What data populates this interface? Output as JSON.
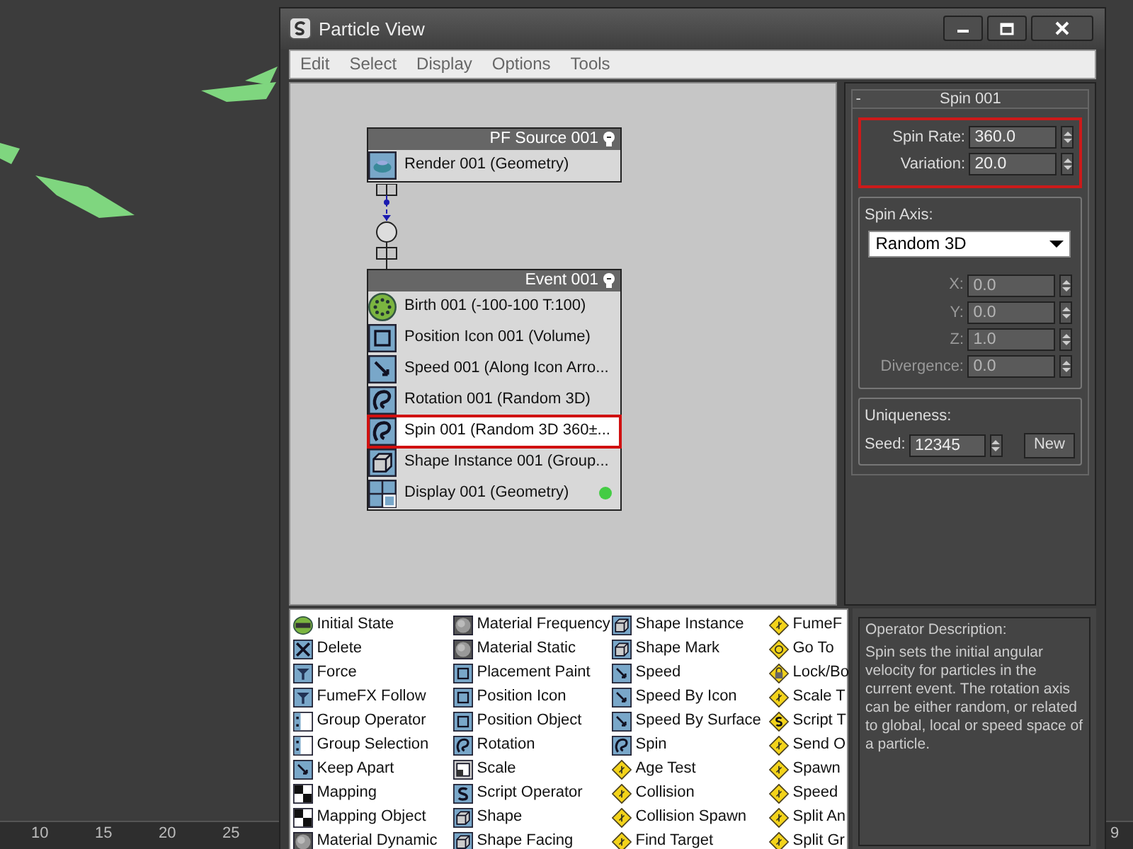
{
  "viewport": {
    "ruler_labels": [
      "10",
      "15",
      "20",
      "25",
      "9"
    ]
  },
  "window": {
    "title": "Particle View"
  },
  "menu": [
    "Edit",
    "Select",
    "Display",
    "Options",
    "Tools"
  ],
  "nodes": [
    {
      "title": "PF Source 001",
      "items": [
        {
          "label": "Render 001 (Geometry)",
          "kind": "render",
          "selected": false,
          "highlighted": false
        }
      ]
    },
    {
      "title": "Event 001",
      "items": [
        {
          "label": "Birth 001 (-100-100 T:100)",
          "kind": "birth",
          "selected": false,
          "highlighted": false
        },
        {
          "label": "Position Icon 001 (Volume)",
          "kind": "position",
          "selected": false,
          "highlighted": false
        },
        {
          "label": "Speed 001 (Along Icon Arro...",
          "kind": "speed",
          "selected": false,
          "highlighted": false
        },
        {
          "label": "Rotation 001 (Random 3D)",
          "kind": "rotation",
          "selected": false,
          "highlighted": false
        },
        {
          "label": "Spin 001 (Random 3D 360±...",
          "kind": "rotation",
          "selected": true,
          "highlighted": true
        },
        {
          "label": "Shape Instance 001 (Group...",
          "kind": "shape",
          "selected": false,
          "highlighted": false
        },
        {
          "label": "Display 001 (Geometry)",
          "kind": "display",
          "selected": false,
          "highlighted": false,
          "color": "#44cc44"
        }
      ]
    }
  ],
  "rollout": {
    "title": "Spin 001",
    "collapse": "-",
    "rate_group": {
      "highlighted": true,
      "fields": [
        {
          "label": "Spin Rate:",
          "value": "360.0",
          "disabled": false
        },
        {
          "label": "Variation:",
          "value": "20.0",
          "disabled": false
        }
      ]
    },
    "axis_group": {
      "title": "Spin Axis:",
      "dropdown": "Random 3D",
      "fields": [
        {
          "label": "X:",
          "value": "0.0",
          "disabled": true
        },
        {
          "label": "Y:",
          "value": "0.0",
          "disabled": true
        },
        {
          "label": "Z:",
          "value": "1.0",
          "disabled": true
        },
        {
          "label": "Divergence:",
          "value": "0.0",
          "disabled": true
        }
      ]
    },
    "uniqueness": {
      "title": "Uniqueness:",
      "label": "Seed:",
      "value": "12345",
      "button": "New"
    }
  },
  "depot": [
    [
      {
        "label": "Initial State",
        "kind": "initial"
      },
      {
        "label": "Delete",
        "kind": "delete"
      },
      {
        "label": "Force",
        "kind": "force"
      },
      {
        "label": "FumeFX Follow",
        "kind": "force"
      },
      {
        "label": "Group Operator",
        "kind": "group"
      },
      {
        "label": "Group Selection",
        "kind": "group"
      },
      {
        "label": "Keep Apart",
        "kind": "speed"
      },
      {
        "label": "Mapping",
        "kind": "mapping"
      },
      {
        "label": "Mapping Object",
        "kind": "mapping"
      },
      {
        "label": "Material Dynamic",
        "kind": "material"
      }
    ],
    [
      {
        "label": "Material Frequency",
        "kind": "material"
      },
      {
        "label": "Material Static",
        "kind": "material"
      },
      {
        "label": "Placement Paint",
        "kind": "position"
      },
      {
        "label": "Position Icon",
        "kind": "position"
      },
      {
        "label": "Position Object",
        "kind": "position"
      },
      {
        "label": "Rotation",
        "kind": "rotation"
      },
      {
        "label": "Scale",
        "kind": "scale"
      },
      {
        "label": "Script Operator",
        "kind": "script"
      },
      {
        "label": "Shape",
        "kind": "shape"
      },
      {
        "label": "Shape Facing",
        "kind": "shape"
      }
    ],
    [
      {
        "label": "Shape Instance",
        "kind": "shape"
      },
      {
        "label": "Shape Mark",
        "kind": "shape"
      },
      {
        "label": "Speed",
        "kind": "speed"
      },
      {
        "label": "Speed By Icon",
        "kind": "speed"
      },
      {
        "label": "Speed By Surface",
        "kind": "speed"
      },
      {
        "label": "Spin",
        "kind": "rotation"
      },
      {
        "label": "Age Test",
        "kind": "test"
      },
      {
        "label": "Collision",
        "kind": "test"
      },
      {
        "label": "Collision Spawn",
        "kind": "test"
      },
      {
        "label": "Find Target",
        "kind": "test"
      }
    ],
    [
      {
        "label": "FumeF",
        "kind": "test"
      },
      {
        "label": "Go To",
        "kind": "goto"
      },
      {
        "label": "Lock/Bo",
        "kind": "lock"
      },
      {
        "label": "Scale T",
        "kind": "test"
      },
      {
        "label": "Script T",
        "kind": "testscript"
      },
      {
        "label": "Send O",
        "kind": "test"
      },
      {
        "label": "Spawn",
        "kind": "test"
      },
      {
        "label": "Speed",
        "kind": "test"
      },
      {
        "label": "Split An",
        "kind": "test"
      },
      {
        "label": "Split Gr",
        "kind": "test"
      }
    ]
  ],
  "description": {
    "title": "Operator Description:",
    "text": "Spin sets the initial angular velocity for particles in the current event. The rotation axis can be either random, or related to global, local or speed space of a particle."
  }
}
